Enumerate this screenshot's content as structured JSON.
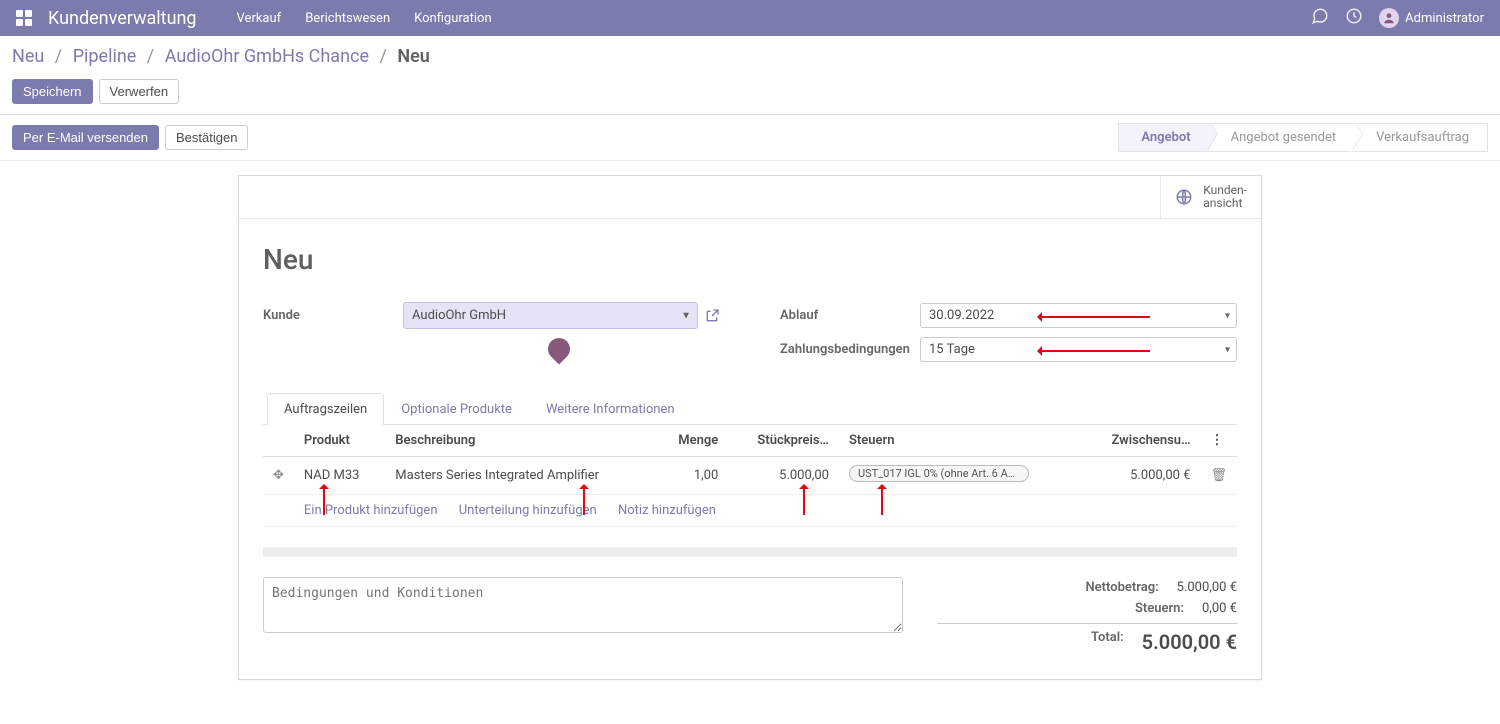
{
  "topbar": {
    "app_title": "Kundenverwaltung",
    "menu": [
      "Verkauf",
      "Berichtswesen",
      "Konfiguration"
    ],
    "user": "Administrator"
  },
  "breadcrumbs": {
    "items": [
      "Neu",
      "Pipeline",
      "AudioOhr GmbHs Chance"
    ],
    "current": "Neu"
  },
  "edit_buttons": {
    "save": "Speichern",
    "discard": "Verwerfen"
  },
  "status_actions": {
    "send": "Per E-Mail versenden",
    "confirm": "Bestätigen"
  },
  "stages": {
    "s1": "Angebot",
    "s2": "Angebot gesendet",
    "s3": "Verkaufsauftrag"
  },
  "stat_button": {
    "line1": "Kunden-",
    "line2": "ansicht"
  },
  "record": {
    "title": "Neu"
  },
  "fields": {
    "customer_label": "Kunde",
    "customer_value": "AudioOhr GmbH",
    "expiry_label": "Ablauf",
    "expiry_value": "30.09.2022",
    "terms_label": "Zahlungsbedingungen",
    "terms_value": "15 Tage"
  },
  "tabs": {
    "t1": "Auftragszeilen",
    "t2": "Optionale Produkte",
    "t3": "Weitere Informationen"
  },
  "table": {
    "headers": {
      "product": "Produkt",
      "description": "Beschreibung",
      "qty": "Menge",
      "price": "Stückpreis…",
      "tax": "Steuern",
      "subtotal": "Zwischensu…"
    },
    "row": {
      "product": "NAD M33",
      "description": "Masters Series Integrated Amplifier",
      "qty": "1,00",
      "price": "5.000,00",
      "tax": "UST_017 IGL 0% (ohne Art. 6 Ab…",
      "subtotal": "5.000,00 €"
    },
    "actions": {
      "add_product": "Ein Produkt hinzufügen",
      "add_section": "Unterteilung hinzufügen",
      "add_note": "Notiz hinzufügen"
    }
  },
  "terms_placeholder": "Bedingungen und Konditionen",
  "totals": {
    "net_label": "Nettobetrag:",
    "net_value": "5.000,00 €",
    "tax_label": "Steuern:",
    "tax_value": "0,00 €",
    "total_label": "Total:",
    "total_value": "5.000,00 €"
  }
}
